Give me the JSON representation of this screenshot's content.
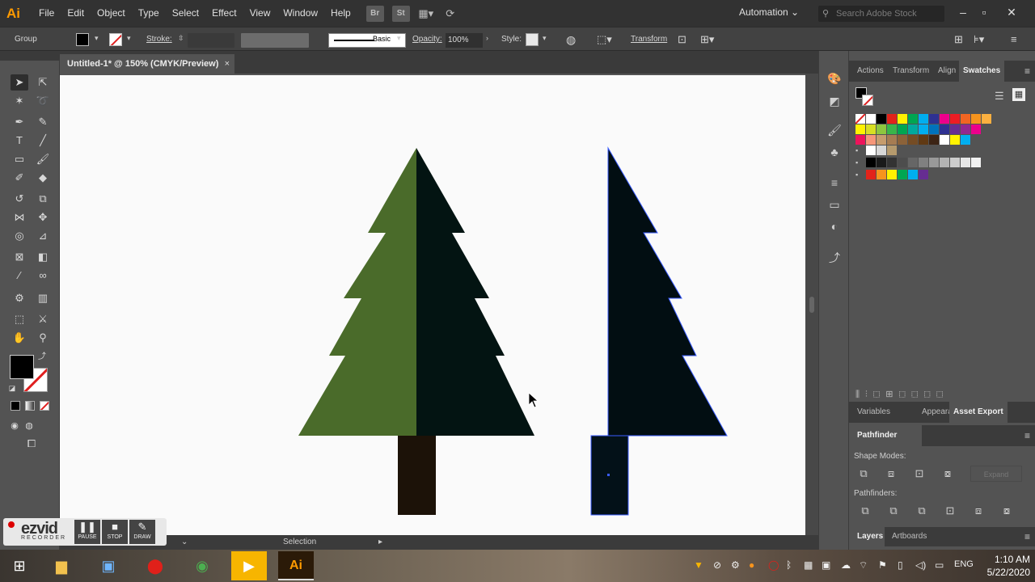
{
  "app": {
    "logo_text": "Ai",
    "menu": [
      "File",
      "Edit",
      "Object",
      "Type",
      "Select",
      "Effect",
      "View",
      "Window",
      "Help"
    ],
    "bridge_label": "Br",
    "stock_label": "St",
    "workspace": "Automation",
    "search_placeholder": "Search Adobe Stock"
  },
  "control": {
    "selection_type": "Group",
    "stroke_label": "Stroke:",
    "brush_label": "Basic",
    "opacity_label": "Opacity:",
    "opacity_value": "100%",
    "style_label": "Style:",
    "transform_label": "Transform"
  },
  "document": {
    "tab_title": "Untitled-1* @ 150% (CMYK/Preview)",
    "close_glyph": "×"
  },
  "status": {
    "tool_name": "Selection"
  },
  "artwork": {
    "tree1_left_color": "#4a6b2a",
    "tree1_right_color": "#031412",
    "tree1_trunk_color": "#1c1208",
    "tree2_color": "#020e12",
    "tree2_trunk_color": "#031118",
    "selection_color": "#3a5cff"
  },
  "panels": {
    "top_tabs": [
      "Actions",
      "Transform",
      "Align",
      "Swatches"
    ],
    "mid_tabs": [
      "Variables",
      "Appearance",
      "Asset Export"
    ],
    "pathfinder_tab": "Pathfinder",
    "shape_modes_label": "Shape Modes:",
    "expand_label": "Expand",
    "pathfinders_label": "Pathfinders:",
    "bottom_tabs": [
      "Layers",
      "Artboards"
    ]
  },
  "swatches": {
    "row1": [
      "#ffffff",
      "#000000",
      "#e2231a",
      "#fff200",
      "#00a651",
      "#00aeef",
      "#2e3192",
      "#ec008c",
      "#ed1c24",
      "#f26522",
      "#f7941d",
      "#fbb040"
    ],
    "row2": [
      "#fff200",
      "#d7df23",
      "#8dc63f",
      "#39b54a",
      "#00a651",
      "#00a99d",
      "#00aeef",
      "#0072bc",
      "#2e3192",
      "#662d91",
      "#92278f",
      "#ec008c"
    ],
    "row3": [
      "#ed145b",
      "#f69679",
      "#c69c6d",
      "#a67c52",
      "#8c6239",
      "#754c24",
      "#603913",
      "#3c2415",
      "#ffffff",
      "#fff200",
      "#00aeef"
    ],
    "row4": [
      "#ffffff",
      "#d7d7d7",
      "#b59a6d"
    ],
    "grays": [
      "#000000",
      "#1a1a1a",
      "#333333",
      "#4d4d4d",
      "#666666",
      "#808080",
      "#999999",
      "#b3b3b3",
      "#cccccc",
      "#e6e6e6",
      "#f2f2f2"
    ],
    "brights": [
      "#e2231a",
      "#f7941d",
      "#fff200",
      "#00a651",
      "#00aeef",
      "#662d91"
    ]
  },
  "recorder": {
    "brand": "ezvid",
    "sub": "RECORDER",
    "pause": "PAUSE",
    "stop": "STOP",
    "draw": "DRAW"
  },
  "taskbar": {
    "language": "ENG",
    "time": "1:10 AM",
    "date": "5/22/2020",
    "ai_label": "Ai"
  }
}
